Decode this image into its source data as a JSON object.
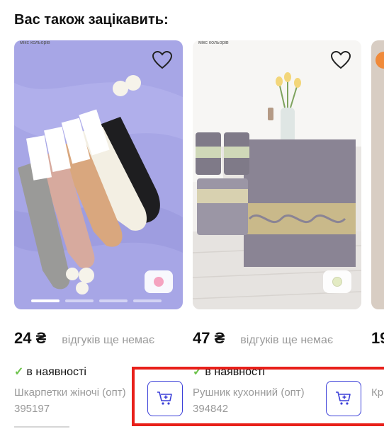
{
  "section": {
    "title": "Вас також зацікавить:"
  },
  "products": [
    {
      "tag": "мікс кольорів",
      "price": "24 ₴",
      "reviews": "відгуків ще немає",
      "availability": "в наявності",
      "name": "Шкарпетки жіночі (опт) 395197",
      "swatch_color": "#f5a3c0",
      "favorite_icon": "heart-outline-icon",
      "cart_icon": "cart-plus-icon",
      "slides": 4,
      "active_slide": 1
    },
    {
      "tag": "мікс кольорів",
      "price": "47 ₴",
      "reviews": "відгуків ще немає",
      "availability": "в наявності",
      "name": "Рушник кухонний (опт) 394842",
      "swatch_color": "#e3ebc3",
      "favorite_icon": "heart-outline-icon",
      "cart_icon": "cart-plus-icon"
    },
    {
      "price": "19",
      "name": "Кр"
    }
  ],
  "colors": {
    "accent": "#3b3fd8",
    "in_stock": "#6cc24a",
    "muted_text": "#9a9a9a",
    "highlight": "#e8201a"
  }
}
